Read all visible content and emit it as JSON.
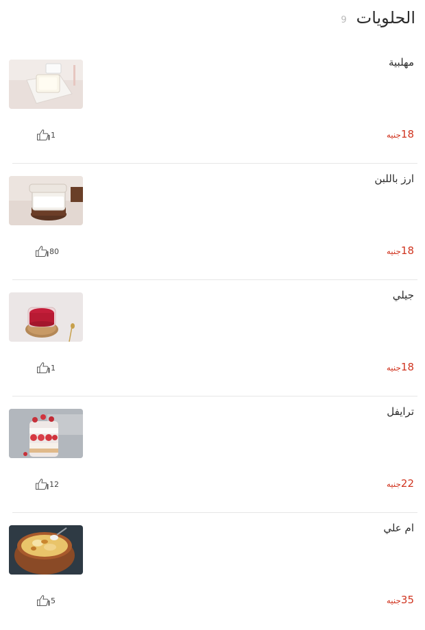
{
  "section": {
    "title": "الحلويات",
    "count": "9"
  },
  "items": [
    {
      "name": "مهلبية",
      "price": "18",
      "currency": "جنيه",
      "likes": "1",
      "image_icon": "muhallabia-photo"
    },
    {
      "name": "ارز باللبن",
      "price": "18",
      "currency": "جنيه",
      "likes": "80",
      "image_icon": "rice-pudding-photo"
    },
    {
      "name": "جيلي",
      "price": "18",
      "currency": "جنيه",
      "likes": "1",
      "image_icon": "jelly-photo"
    },
    {
      "name": "ترايفل",
      "price": "22",
      "currency": "جنيه",
      "likes": "12",
      "image_icon": "trifle-photo"
    },
    {
      "name": "ام علي",
      "price": "35",
      "currency": "جنيه",
      "likes": "5",
      "image_icon": "om-ali-photo"
    }
  ],
  "colors": {
    "price": "#d0341f",
    "divider": "#e6e6e6",
    "title": "#2b2b2b"
  }
}
